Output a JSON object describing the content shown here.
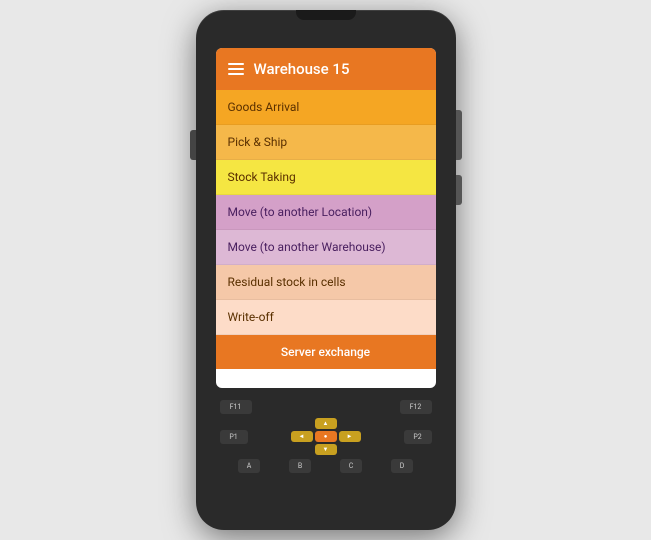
{
  "device": {
    "screen": {
      "header": {
        "title": "Warehouse 15",
        "menu_icon": "hamburger-icon"
      },
      "menu_items": [
        {
          "id": "goods-arrival",
          "label": "Goods Arrival",
          "color": "#f5a623",
          "text_color": "#5a3000"
        },
        {
          "id": "pick-ship",
          "label": "Pick & Ship",
          "color": "#f5b84a",
          "text_color": "#5a3000"
        },
        {
          "id": "stock-taking",
          "label": "Stock Taking",
          "color": "#f5e642",
          "text_color": "#5a3000"
        },
        {
          "id": "move-location",
          "label": "Move (to another Location)",
          "color": "#d4a0c8",
          "text_color": "#4a2060"
        },
        {
          "id": "move-warehouse",
          "label": "Move (to another Warehouse)",
          "color": "#ddb8d5",
          "text_color": "#4a2060"
        },
        {
          "id": "residual-stock",
          "label": "Residual stock in cells",
          "color": "#f5c8a8",
          "text_color": "#5a3000"
        },
        {
          "id": "write-off",
          "label": "Write-off",
          "color": "#fddcc8",
          "text_color": "#5a3000"
        }
      ],
      "server_btn": "Server exchange"
    },
    "keypad": {
      "fn_keys": [
        "F11",
        "F12"
      ],
      "p_keys": [
        "P1",
        "P2"
      ],
      "alpha_keys": [
        "A",
        "B",
        "C",
        "D"
      ],
      "nav_arrows": [
        "▲",
        "◄",
        "►",
        "▼"
      ]
    }
  }
}
